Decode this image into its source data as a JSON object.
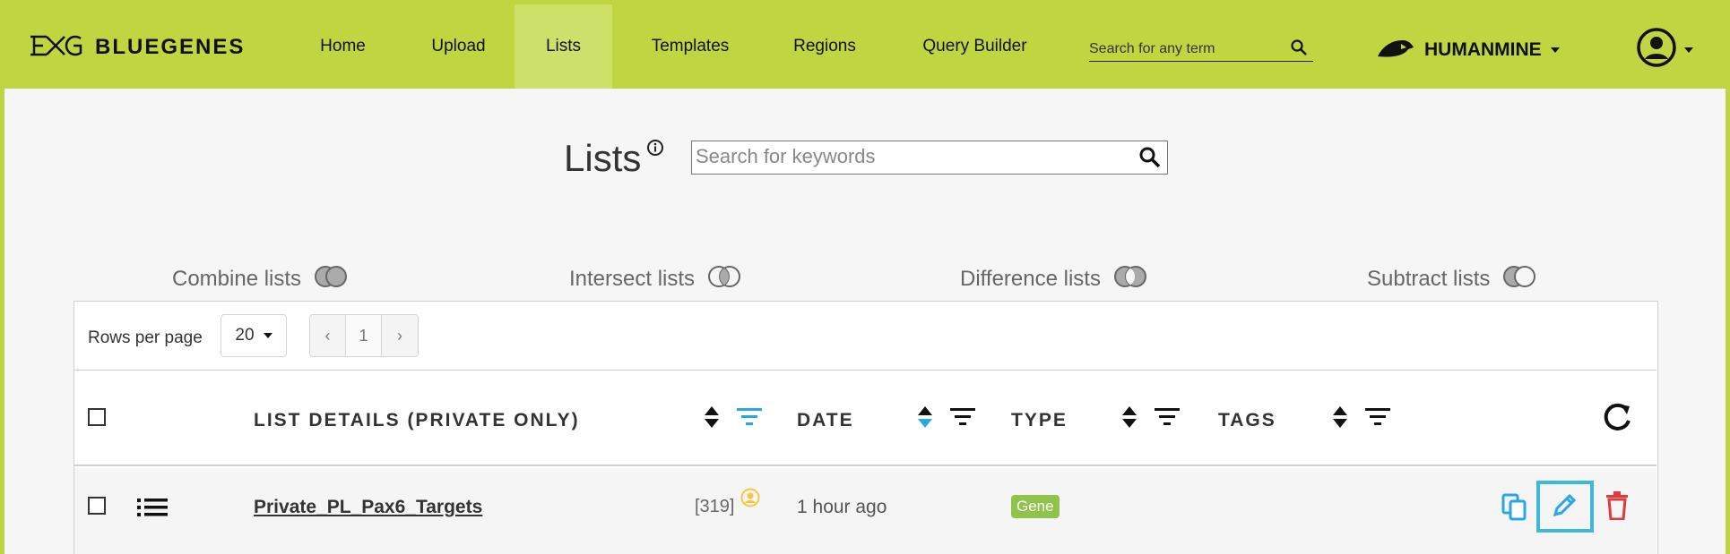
{
  "brand": {
    "name": "BLUEGENES"
  },
  "nav": {
    "items": [
      {
        "label": "Home"
      },
      {
        "label": "Upload"
      },
      {
        "label": "Lists"
      },
      {
        "label": "Templates"
      },
      {
        "label": "Regions"
      },
      {
        "label": "Query Builder"
      }
    ],
    "active": "Lists",
    "search_placeholder": "Search for any term",
    "mine_name": "HUMANMINE"
  },
  "page": {
    "title": "Lists",
    "keyword_placeholder": "Search for keywords"
  },
  "operations": [
    {
      "label": "Combine lists"
    },
    {
      "label": "Intersect lists"
    },
    {
      "label": "Difference lists"
    },
    {
      "label": "Subtract lists"
    }
  ],
  "pagination": {
    "rows_label": "Rows per page",
    "rows_value": "20",
    "prev": "‹",
    "page": "1",
    "next": "›"
  },
  "table": {
    "headers": {
      "details": "LIST DETAILS (PRIVATE ONLY)",
      "date": "DATE",
      "type": "TYPE",
      "tags": "TAGS"
    },
    "rows": [
      {
        "name": "Private_PL_Pax6_Targets",
        "count": "[319]",
        "date": "1 hour ago",
        "type": "Gene"
      }
    ]
  },
  "colors": {
    "navbar": "#bfd641",
    "active_tab": "#cde06a",
    "accent_blue": "#2aa6e6",
    "delete_red": "#e03b3b",
    "type_badge": "#8fc34a",
    "owner_icon": "#f3c83a"
  },
  "icons": [
    "logo-icon",
    "search-icon",
    "mine-logo-icon",
    "user-icon",
    "info-icon",
    "venn-icon",
    "sort-icon",
    "filter-icon",
    "refresh-icon",
    "list-icon",
    "copy-icon",
    "edit-icon",
    "delete-icon"
  ]
}
